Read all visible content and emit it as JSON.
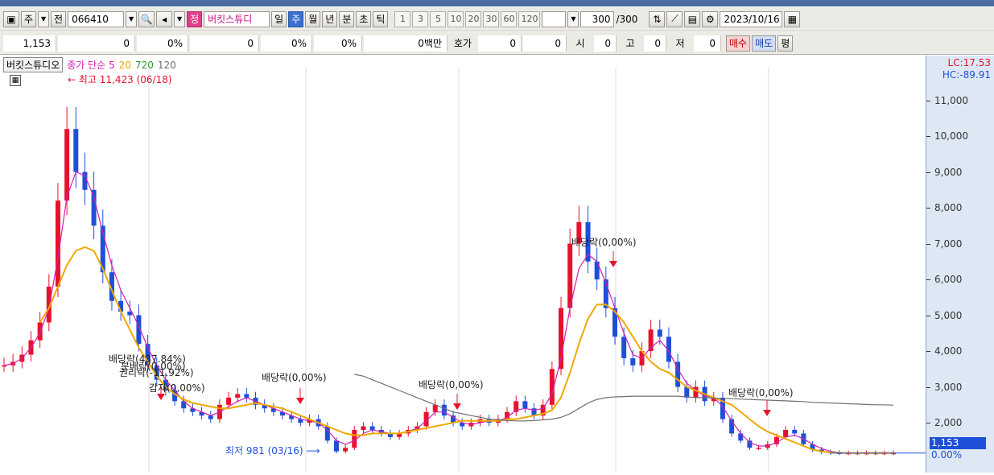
{
  "toolbar": {
    "type_label": "주",
    "prev_label": "전",
    "code": "066410",
    "stock_name_tag": "정",
    "stock_name": "버킷스튜디",
    "periods": [
      "일",
      "주",
      "월",
      "년",
      "분",
      "초",
      "틱"
    ],
    "active_period": "주",
    "numbers": [
      "1",
      "3",
      "5",
      "10",
      "20",
      "30",
      "60",
      "120"
    ],
    "count_value": "300",
    "count_total": "/300",
    "date": "2023/10/16"
  },
  "quote": {
    "price": "1,153",
    "change": "0",
    "change_pct": "0%",
    "volume": "0",
    "pct2": "0%",
    "pct3": "0%",
    "amount": "0백만",
    "hoga_label": "호가",
    "hoga1": "0",
    "hoga2": "0",
    "open_label": "시",
    "open": "0",
    "high_label": "고",
    "high": "0",
    "low_label": "저",
    "low": "0",
    "buy": "매수",
    "sell": "매도",
    "flat": "평"
  },
  "legend": {
    "name": "버킷스튜디오",
    "series_label": "종가 단순 5",
    "ma20": "20",
    "ma720": "720",
    "ma120": "120",
    "lc": "LC:17.53",
    "hc": "HC:-89.91"
  },
  "annotations": {
    "high": "최고 11,423 (06/18)",
    "low": "최저 981 (03/16)",
    "dividend": "배당락(0,00%)",
    "event1": "배당락(437.84%)",
    "event2": "권리락(-11.92%)",
    "event3": "분배락(0.00%)",
    "event4": "감자(0,00%)"
  },
  "current": {
    "price": "1,153",
    "pct": "0.00%"
  },
  "colors": {
    "up": "#e8112d",
    "down": "#1f4fd6",
    "ma5": "#d21fb4",
    "ma20": "#f0a800",
    "ma720": "#707070",
    "accent": "#3a6fd0"
  },
  "chart_data": {
    "type": "line",
    "y_axis_ticks": [
      "11,000",
      "10,000",
      "9,000",
      "8,000",
      "7,000",
      "6,000",
      "5,000",
      "4,000",
      "3,000",
      "2,000"
    ],
    "ylim": [
      900,
      11800
    ],
    "series": [
      {
        "name": "종가",
        "values": [
          3600,
          3700,
          3900,
          4300,
          4800,
          5800,
          8200,
          10200,
          9000,
          8500,
          7500,
          6200,
          5400,
          5100,
          5000,
          4200,
          3600,
          3200,
          2900,
          2600,
          2400,
          2300,
          2200,
          2100,
          2500,
          2700,
          2800,
          2700,
          2500,
          2400,
          2300,
          2200,
          2100,
          2000,
          2100,
          1900,
          1500,
          1200,
          1300,
          1800,
          1900,
          1800,
          1700,
          1600,
          1700,
          1800,
          1900,
          2300,
          2500,
          2200,
          2000,
          1900,
          2000,
          2100,
          2000,
          2100,
          2300,
          2600,
          2400,
          2200,
          2500,
          3500,
          5200,
          7000,
          7600,
          6500,
          6000,
          5200,
          4400,
          3800,
          3600,
          4000,
          4600,
          4400,
          3700,
          3000,
          2700,
          3000,
          2600,
          2700,
          2100,
          1700,
          1500,
          1300,
          1300,
          1400,
          1600,
          1800,
          1700,
          1400,
          1250,
          1180,
          1160,
          1153,
          1153,
          1153,
          1153,
          1153,
          1153,
          1153
        ]
      },
      {
        "name": "5",
        "values": [
          3600,
          3650,
          3800,
          4100,
          4500,
          5200,
          6600,
          8300,
          9000,
          8900,
          8300,
          7300,
          6400,
          5700,
          5200,
          4700,
          4100,
          3600,
          3200,
          2900,
          2600,
          2400,
          2300,
          2200,
          2300,
          2450,
          2600,
          2700,
          2600,
          2500,
          2400,
          2300,
          2200,
          2100,
          2050,
          2000,
          1800,
          1500,
          1400,
          1500,
          1700,
          1800,
          1750,
          1700,
          1700,
          1750,
          1850,
          2050,
          2300,
          2300,
          2150,
          2000,
          1950,
          2000,
          2050,
          2050,
          2150,
          2350,
          2400,
          2350,
          2400,
          2800,
          3800,
          5200,
          6300,
          6700,
          6500,
          5900,
          5200,
          4500,
          3900,
          3800,
          4100,
          4300,
          4000,
          3500,
          3100,
          2900,
          2750,
          2700,
          2450,
          2050,
          1700,
          1450,
          1350,
          1350,
          1450,
          1600,
          1650,
          1550,
          1400,
          1280,
          1200,
          1170,
          1155,
          1153,
          1153,
          1153,
          1153,
          1153
        ]
      },
      {
        "name": "20",
        "values": [
          null,
          null,
          null,
          null,
          4800,
          5200,
          5800,
          6400,
          6800,
          6900,
          6800,
          6300,
          5700,
          5100,
          4600,
          4100,
          3700,
          3300,
          3000,
          2800,
          2650,
          2550,
          2500,
          2450,
          2400,
          2400,
          2450,
          2500,
          2550,
          2500,
          2450,
          2400,
          2300,
          2200,
          2100,
          2000,
          1900,
          1800,
          1700,
          1650,
          1650,
          1700,
          1700,
          1700,
          1700,
          1750,
          1800,
          1850,
          1900,
          1950,
          2000,
          2050,
          2050,
          2050,
          2050,
          2050,
          2100,
          2100,
          2150,
          2200,
          2250,
          2350,
          2700,
          3400,
          4200,
          4900,
          5300,
          5300,
          5100,
          4800,
          4400,
          4000,
          3700,
          3500,
          3400,
          3200,
          3000,
          2900,
          2800,
          2700,
          2600,
          2500,
          2300,
          2100,
          1900,
          1750,
          1650,
          1550,
          1450,
          1350,
          1250,
          1200,
          1170,
          1160,
          1155,
          1153,
          1153,
          1153,
          1153,
          1153
        ]
      },
      {
        "name": "720",
        "values": [
          null,
          null,
          null,
          null,
          null,
          null,
          null,
          null,
          null,
          null,
          null,
          null,
          null,
          null,
          null,
          null,
          null,
          null,
          null,
          null,
          null,
          null,
          null,
          null,
          null,
          null,
          null,
          null,
          null,
          null,
          null,
          null,
          null,
          null,
          null,
          null,
          null,
          null,
          null,
          3350,
          3300,
          3200,
          3100,
          3000,
          2900,
          2800,
          2700,
          2600,
          2500,
          2400,
          2300,
          2250,
          2200,
          2150,
          2100,
          2080,
          2060,
          2050,
          2050,
          2060,
          2080,
          2100,
          2150,
          2250,
          2400,
          2550,
          2650,
          2700,
          2720,
          2730,
          2740,
          2740,
          2740,
          2740,
          2740,
          2740,
          2720,
          2700,
          2700,
          2690,
          2680,
          2670,
          2660,
          2650,
          2640,
          2630,
          2620,
          2610,
          2600,
          2590,
          2570,
          2560,
          2550,
          2540,
          2530,
          2520,
          2510,
          2500,
          2500,
          2490
        ]
      }
    ]
  }
}
